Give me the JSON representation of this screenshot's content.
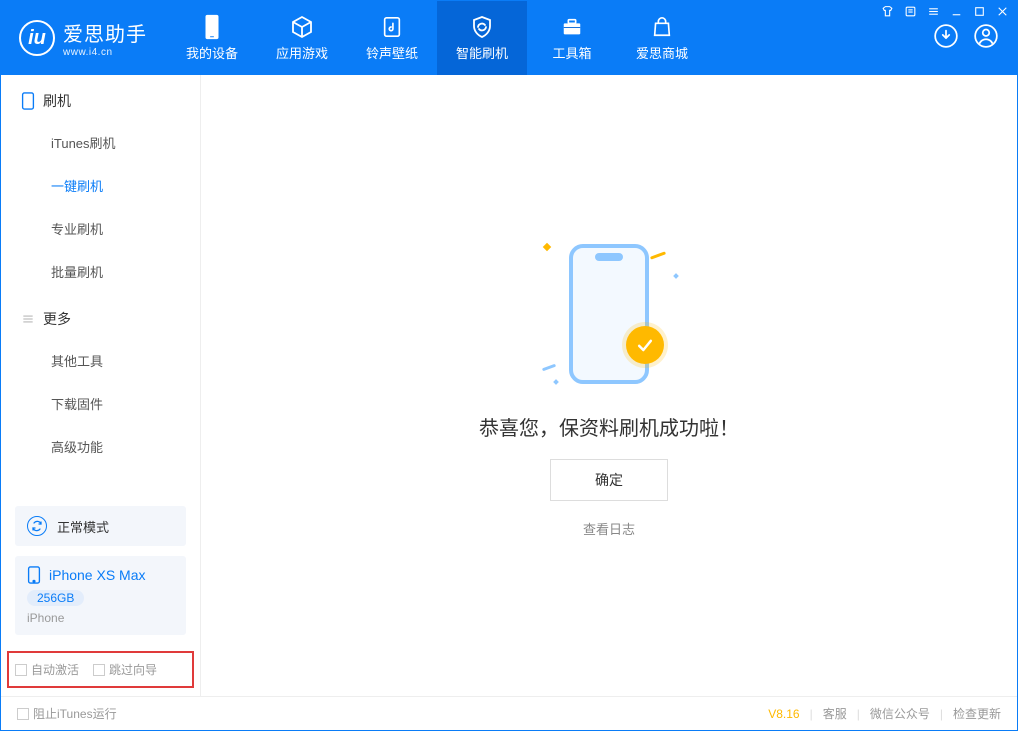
{
  "logo": {
    "main": "爱思助手",
    "sub": "www.i4.cn",
    "glyph": "iu"
  },
  "tabs": [
    {
      "label": "我的设备"
    },
    {
      "label": "应用游戏"
    },
    {
      "label": "铃声壁纸"
    },
    {
      "label": "智能刷机"
    },
    {
      "label": "工具箱"
    },
    {
      "label": "爱思商城"
    }
  ],
  "sidebar": {
    "group1_title": "刷机",
    "group1": [
      {
        "label": "iTunes刷机"
      },
      {
        "label": "一键刷机"
      },
      {
        "label": "专业刷机"
      },
      {
        "label": "批量刷机"
      }
    ],
    "group2_title": "更多",
    "group2": [
      {
        "label": "其他工具"
      },
      {
        "label": "下载固件"
      },
      {
        "label": "高级功能"
      }
    ]
  },
  "mode": {
    "label": "正常模式"
  },
  "device": {
    "name": "iPhone XS Max",
    "capacity": "256GB",
    "type": "iPhone"
  },
  "options": {
    "auto_activate": "自动激活",
    "skip_wizard": "跳过向导"
  },
  "main": {
    "success": "恭喜您，保资料刷机成功啦！",
    "ok": "确定",
    "view_log": "查看日志"
  },
  "footer": {
    "block_itunes": "阻止iTunes运行",
    "version": "V8.16",
    "links": [
      "客服",
      "微信公众号",
      "检查更新"
    ]
  }
}
